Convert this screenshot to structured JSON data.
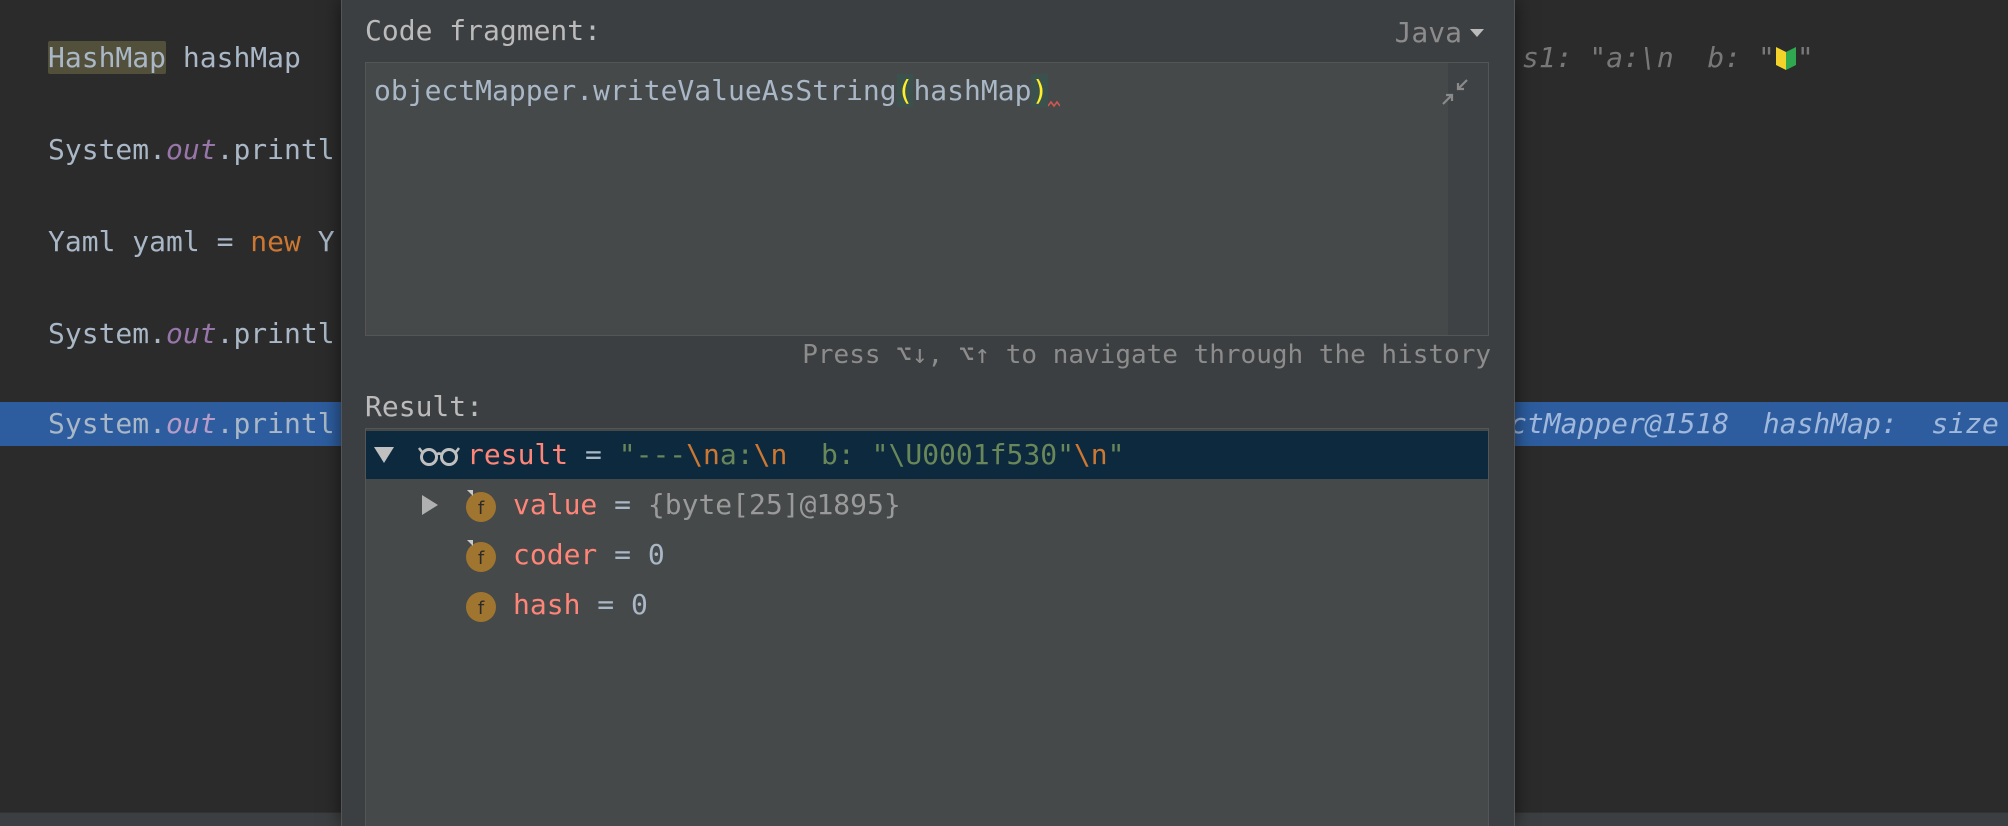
{
  "editor": {
    "lines": [
      {
        "pre": "",
        "highlight": "HashMap",
        "rest": " hashMap "
      },
      {
        "pre": "System.",
        "field": "out",
        "rest": ".printl"
      },
      {
        "pre": "Yaml yaml = ",
        "kw": "new",
        "rest": " Y"
      },
      {
        "pre": "System.",
        "field": "out",
        "rest": ".printl"
      },
      {
        "pre": "System.",
        "field": "out",
        "rest": ".printl"
      }
    ],
    "hint_top": "s1: \"a:\\n  b: \"",
    "hint_selected": "ctMapper@1518  hashMap:  size"
  },
  "dialog": {
    "code_fragment_label": "Code fragment:",
    "language": "Java",
    "code": {
      "call": "objectMapper.writeValueAsString",
      "open_paren": "(",
      "arg": "hashMap",
      "close_paren": ")"
    },
    "history_hint": "Press ⌥↓, ⌥↑ to navigate through the history",
    "result_label": "Result:"
  },
  "result_tree": {
    "root": {
      "name": "result",
      "eq": " = ",
      "value_parts": [
        {
          "t": "\"---",
          "c": "q"
        },
        {
          "t": "\\n",
          "c": "e"
        },
        {
          "t": "a:",
          "c": "q"
        },
        {
          "t": "\\n",
          "c": "e"
        },
        {
          "t": "  b: \"",
          "c": "q"
        },
        {
          "t": "\\U0001f530",
          "c": "q"
        },
        {
          "t": "\"",
          "c": "q"
        },
        {
          "t": "\\n",
          "c": "e"
        },
        {
          "t": "\"",
          "c": "q"
        }
      ]
    },
    "children": [
      {
        "name": "value",
        "eq": " = ",
        "value": "{byte[25]@1895}",
        "icon": "field-icon",
        "expandable": true,
        "kind": "obj"
      },
      {
        "name": "coder",
        "eq": " = ",
        "value": "0",
        "icon": "field-icon",
        "expandable": false,
        "kind": "num"
      },
      {
        "name": "hash",
        "eq": " = ",
        "value": "0",
        "icon": "field-icon",
        "expandable": false,
        "kind": "num"
      }
    ]
  },
  "colors": {
    "editor_bg": "#2b2b2b",
    "dialog_bg": "#3c3f41",
    "selection": "#2d5d9f",
    "tree_selected": "#0d293e",
    "field_name": "#ff8578",
    "string": "#6a8759",
    "escape": "#cc7832"
  }
}
